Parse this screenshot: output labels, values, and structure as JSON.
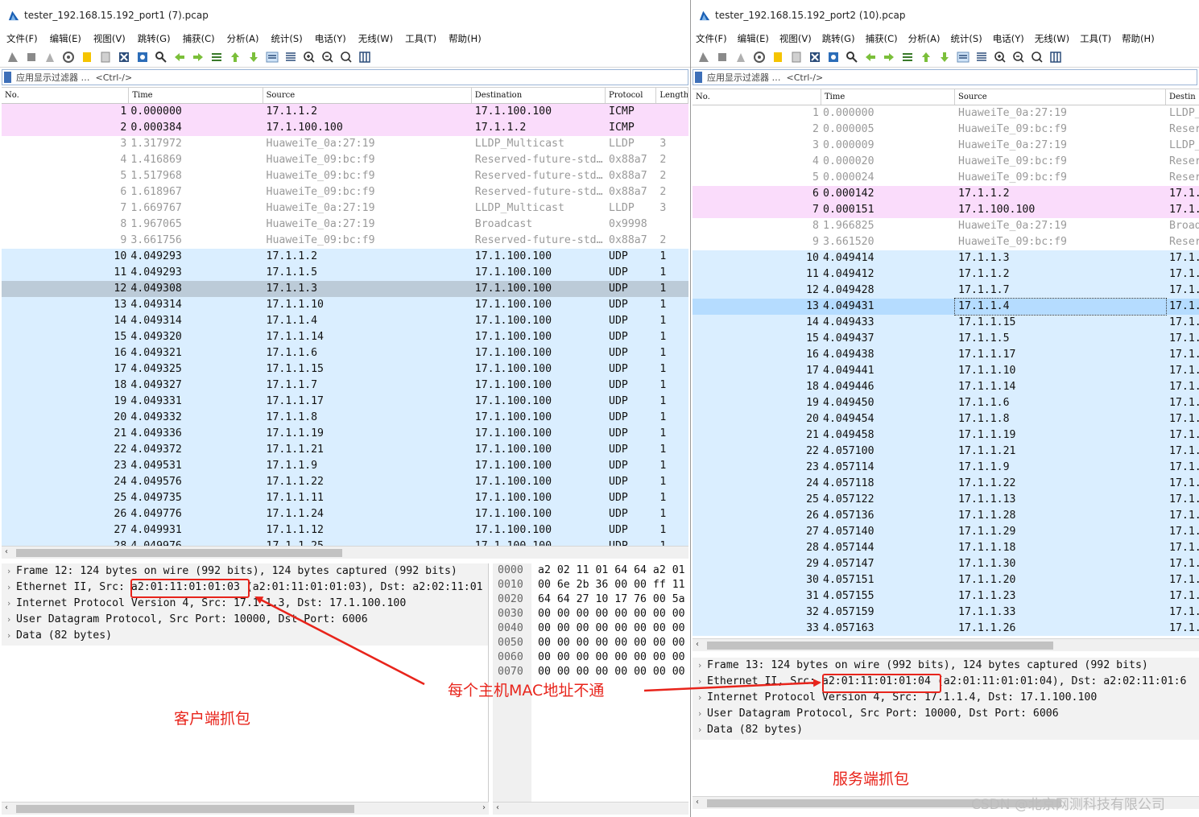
{
  "colors": {
    "icmp": "#fadcfb",
    "udp": "#daeeff",
    "default": "#ffffff",
    "selected_grey": "#bccbd8",
    "selected_blue": "#b5dcff",
    "annotation": "#e8241b"
  },
  "menu": [
    "文件(F)",
    "编辑(E)",
    "视图(V)",
    "跳转(G)",
    "捕获(C)",
    "分析(A)",
    "统计(S)",
    "电话(Y)",
    "无线(W)",
    "工具(T)",
    "帮助(H)"
  ],
  "filter": {
    "label": "应用显示过滤器 …",
    "hint": "<Ctrl-/>"
  },
  "window1": {
    "title": "tester_192.168.15.192_port1 (7).pcap",
    "columns": [
      "No.",
      "Time",
      "Source",
      "Destination",
      "Protocol",
      "Length"
    ],
    "rows": [
      {
        "no": "1",
        "time": "0.000000",
        "src": "17.1.1.2",
        "dst": "17.1.100.100",
        "proto": "ICMP",
        "len": "",
        "kind": "icmp"
      },
      {
        "no": "2",
        "time": "0.000384",
        "src": "17.1.100.100",
        "dst": "17.1.1.2",
        "proto": "ICMP",
        "len": "",
        "kind": "icmp"
      },
      {
        "no": "3",
        "time": "1.317972",
        "src": "HuaweiTe_0a:27:19",
        "dst": "LLDP_Multicast",
        "proto": "LLDP",
        "len": "3",
        "kind": "grey"
      },
      {
        "no": "4",
        "time": "1.416869",
        "src": "HuaweiTe_09:bc:f9",
        "dst": "Reserved-future-std…",
        "proto": "0x88a7",
        "len": "2",
        "kind": "grey"
      },
      {
        "no": "5",
        "time": "1.517968",
        "src": "HuaweiTe_09:bc:f9",
        "dst": "Reserved-future-std…",
        "proto": "0x88a7",
        "len": "2",
        "kind": "grey"
      },
      {
        "no": "6",
        "time": "1.618967",
        "src": "HuaweiTe_09:bc:f9",
        "dst": "Reserved-future-std…",
        "proto": "0x88a7",
        "len": "2",
        "kind": "grey"
      },
      {
        "no": "7",
        "time": "1.669767",
        "src": "HuaweiTe_0a:27:19",
        "dst": "LLDP_Multicast",
        "proto": "LLDP",
        "len": "3",
        "kind": "grey"
      },
      {
        "no": "8",
        "time": "1.967065",
        "src": "HuaweiTe_0a:27:19",
        "dst": "Broadcast",
        "proto": "0x9998",
        "len": "",
        "kind": "grey"
      },
      {
        "no": "9",
        "time": "3.661756",
        "src": "HuaweiTe_09:bc:f9",
        "dst": "Reserved-future-std…",
        "proto": "0x88a7",
        "len": "2",
        "kind": "grey"
      },
      {
        "no": "10",
        "time": "4.049293",
        "src": "17.1.1.2",
        "dst": "17.1.100.100",
        "proto": "UDP",
        "len": "1",
        "kind": "udp"
      },
      {
        "no": "11",
        "time": "4.049293",
        "src": "17.1.1.5",
        "dst": "17.1.100.100",
        "proto": "UDP",
        "len": "1",
        "kind": "udp"
      },
      {
        "no": "12",
        "time": "4.049308",
        "src": "17.1.1.3",
        "dst": "17.1.100.100",
        "proto": "UDP",
        "len": "1",
        "kind": "sel"
      },
      {
        "no": "13",
        "time": "4.049314",
        "src": "17.1.1.10",
        "dst": "17.1.100.100",
        "proto": "UDP",
        "len": "1",
        "kind": "udp"
      },
      {
        "no": "14",
        "time": "4.049314",
        "src": "17.1.1.4",
        "dst": "17.1.100.100",
        "proto": "UDP",
        "len": "1",
        "kind": "udp"
      },
      {
        "no": "15",
        "time": "4.049320",
        "src": "17.1.1.14",
        "dst": "17.1.100.100",
        "proto": "UDP",
        "len": "1",
        "kind": "udp"
      },
      {
        "no": "16",
        "time": "4.049321",
        "src": "17.1.1.6",
        "dst": "17.1.100.100",
        "proto": "UDP",
        "len": "1",
        "kind": "udp"
      },
      {
        "no": "17",
        "time": "4.049325",
        "src": "17.1.1.15",
        "dst": "17.1.100.100",
        "proto": "UDP",
        "len": "1",
        "kind": "udp"
      },
      {
        "no": "18",
        "time": "4.049327",
        "src": "17.1.1.7",
        "dst": "17.1.100.100",
        "proto": "UDP",
        "len": "1",
        "kind": "udp"
      },
      {
        "no": "19",
        "time": "4.049331",
        "src": "17.1.1.17",
        "dst": "17.1.100.100",
        "proto": "UDP",
        "len": "1",
        "kind": "udp"
      },
      {
        "no": "20",
        "time": "4.049332",
        "src": "17.1.1.8",
        "dst": "17.1.100.100",
        "proto": "UDP",
        "len": "1",
        "kind": "udp"
      },
      {
        "no": "21",
        "time": "4.049336",
        "src": "17.1.1.19",
        "dst": "17.1.100.100",
        "proto": "UDP",
        "len": "1",
        "kind": "udp"
      },
      {
        "no": "22",
        "time": "4.049372",
        "src": "17.1.1.21",
        "dst": "17.1.100.100",
        "proto": "UDP",
        "len": "1",
        "kind": "udp"
      },
      {
        "no": "23",
        "time": "4.049531",
        "src": "17.1.1.9",
        "dst": "17.1.100.100",
        "proto": "UDP",
        "len": "1",
        "kind": "udp"
      },
      {
        "no": "24",
        "time": "4.049576",
        "src": "17.1.1.22",
        "dst": "17.1.100.100",
        "proto": "UDP",
        "len": "1",
        "kind": "udp"
      },
      {
        "no": "25",
        "time": "4.049735",
        "src": "17.1.1.11",
        "dst": "17.1.100.100",
        "proto": "UDP",
        "len": "1",
        "kind": "udp"
      },
      {
        "no": "26",
        "time": "4.049776",
        "src": "17.1.1.24",
        "dst": "17.1.100.100",
        "proto": "UDP",
        "len": "1",
        "kind": "udp"
      },
      {
        "no": "27",
        "time": "4.049931",
        "src": "17.1.1.12",
        "dst": "17.1.100.100",
        "proto": "UDP",
        "len": "1",
        "kind": "udp"
      },
      {
        "no": "28",
        "time": "4.049976",
        "src": "17.1.1.25",
        "dst": "17.1.100.100",
        "proto": "UDP",
        "len": "1",
        "kind": "udp"
      }
    ],
    "details": [
      "Frame 12: 124 bytes on wire (992 bits), 124 bytes captured (992 bits)",
      "Ethernet II, Src: a2:01:11:01:01:03 (a2:01:11:01:01:03), Dst: a2:02:11:01",
      "Internet Protocol Version 4, Src: 17.1.1.3, Dst: 17.1.100.100",
      "User Datagram Protocol, Src Port: 10000, Dst Port: 6006",
      "Data (82 bytes)"
    ],
    "hex_offsets": [
      "0000",
      "0010",
      "0020",
      "0030",
      "0040",
      "0050",
      "0060",
      "0070"
    ],
    "hex_bytes": [
      "a2 02 11 01 64 64 a2 01",
      "00 6e 2b 36 00 00 ff 11",
      "64 64 27 10 17 76 00 5a",
      "00 00 00 00 00 00 00 00",
      "00 00 00 00 00 00 00 00",
      "00 00 00 00 00 00 00 00",
      "00 00 00 00 00 00 00 00",
      "00 00 00 00 00 00 00 00"
    ]
  },
  "window2": {
    "title": "tester_192.168.15.192_port2 (10).pcap",
    "columns": [
      "No.",
      "Time",
      "Source",
      "Destin"
    ],
    "rows": [
      {
        "no": "1",
        "time": "0.000000",
        "src": "HuaweiTe_0a:27:19",
        "dst": "LLDP_",
        "kind": "grey"
      },
      {
        "no": "2",
        "time": "0.000005",
        "src": "HuaweiTe_09:bc:f9",
        "dst": "Reser",
        "kind": "grey"
      },
      {
        "no": "3",
        "time": "0.000009",
        "src": "HuaweiTe_0a:27:19",
        "dst": "LLDP_",
        "kind": "grey"
      },
      {
        "no": "4",
        "time": "0.000020",
        "src": "HuaweiTe_09:bc:f9",
        "dst": "Reser",
        "kind": "grey"
      },
      {
        "no": "5",
        "time": "0.000024",
        "src": "HuaweiTe_09:bc:f9",
        "dst": "Reser",
        "kind": "grey"
      },
      {
        "no": "6",
        "time": "0.000142",
        "src": "17.1.1.2",
        "dst": "17.1.",
        "kind": "icmp"
      },
      {
        "no": "7",
        "time": "0.000151",
        "src": "17.1.100.100",
        "dst": "17.1.",
        "kind": "icmp"
      },
      {
        "no": "8",
        "time": "1.966825",
        "src": "HuaweiTe_0a:27:19",
        "dst": "Broad",
        "kind": "grey"
      },
      {
        "no": "9",
        "time": "3.661520",
        "src": "HuaweiTe_09:bc:f9",
        "dst": "Reser",
        "kind": "grey"
      },
      {
        "no": "10",
        "time": "4.049414",
        "src": "17.1.1.3",
        "dst": "17.1.",
        "kind": "udp"
      },
      {
        "no": "11",
        "time": "4.049412",
        "src": "17.1.1.2",
        "dst": "17.1.",
        "kind": "udp"
      },
      {
        "no": "12",
        "time": "4.049428",
        "src": "17.1.1.7",
        "dst": "17.1.",
        "kind": "udp"
      },
      {
        "no": "13",
        "time": "4.049431",
        "src": "17.1.1.4",
        "dst": "17.1.",
        "kind": "selblue"
      },
      {
        "no": "14",
        "time": "4.049433",
        "src": "17.1.1.15",
        "dst": "17.1.",
        "kind": "udp"
      },
      {
        "no": "15",
        "time": "4.049437",
        "src": "17.1.1.5",
        "dst": "17.1.",
        "kind": "udp"
      },
      {
        "no": "16",
        "time": "4.049438",
        "src": "17.1.1.17",
        "dst": "17.1.",
        "kind": "udp"
      },
      {
        "no": "17",
        "time": "4.049441",
        "src": "17.1.1.10",
        "dst": "17.1.",
        "kind": "udp"
      },
      {
        "no": "18",
        "time": "4.049446",
        "src": "17.1.1.14",
        "dst": "17.1.",
        "kind": "udp"
      },
      {
        "no": "19",
        "time": "4.049450",
        "src": "17.1.1.6",
        "dst": "17.1.",
        "kind": "udp"
      },
      {
        "no": "20",
        "time": "4.049454",
        "src": "17.1.1.8",
        "dst": "17.1.",
        "kind": "udp"
      },
      {
        "no": "21",
        "time": "4.049458",
        "src": "17.1.1.19",
        "dst": "17.1.",
        "kind": "udp"
      },
      {
        "no": "22",
        "time": "4.057100",
        "src": "17.1.1.21",
        "dst": "17.1.",
        "kind": "udp"
      },
      {
        "no": "23",
        "time": "4.057114",
        "src": "17.1.1.9",
        "dst": "17.1.",
        "kind": "udp"
      },
      {
        "no": "24",
        "time": "4.057118",
        "src": "17.1.1.22",
        "dst": "17.1.",
        "kind": "udp"
      },
      {
        "no": "25",
        "time": "4.057122",
        "src": "17.1.1.13",
        "dst": "17.1.",
        "kind": "udp"
      },
      {
        "no": "26",
        "time": "4.057136",
        "src": "17.1.1.28",
        "dst": "17.1.",
        "kind": "udp"
      },
      {
        "no": "27",
        "time": "4.057140",
        "src": "17.1.1.29",
        "dst": "17.1.",
        "kind": "udp"
      },
      {
        "no": "28",
        "time": "4.057144",
        "src": "17.1.1.18",
        "dst": "17.1.",
        "kind": "udp"
      },
      {
        "no": "29",
        "time": "4.057147",
        "src": "17.1.1.30",
        "dst": "17.1.",
        "kind": "udp"
      },
      {
        "no": "30",
        "time": "4.057151",
        "src": "17.1.1.20",
        "dst": "17.1.",
        "kind": "udp"
      },
      {
        "no": "31",
        "time": "4.057155",
        "src": "17.1.1.23",
        "dst": "17.1.",
        "kind": "udp"
      },
      {
        "no": "32",
        "time": "4.057159",
        "src": "17.1.1.33",
        "dst": "17.1.",
        "kind": "udp"
      },
      {
        "no": "33",
        "time": "4.057163",
        "src": "17.1.1.26",
        "dst": "17.1.",
        "kind": "udp"
      }
    ],
    "details": [
      "Frame 13: 124 bytes on wire (992 bits), 124 bytes captured (992 bits)",
      "Ethernet II, Src: a2:01:11:01:01:04 (a2:01:11:01:01:04), Dst: a2:02:11:01:6",
      "Internet Protocol Version 4, Src: 17.1.1.4, Dst: 17.1.100.100",
      "User Datagram Protocol, Src Port: 10000, Dst Port: 6006",
      "Data (82 bytes)"
    ]
  },
  "annotations": {
    "client": "客户端抓包",
    "server": "服务端抓包",
    "mac_note": "每个主机MAC地址不通",
    "watermark": "CSDN @北京网测科技有限公司"
  }
}
